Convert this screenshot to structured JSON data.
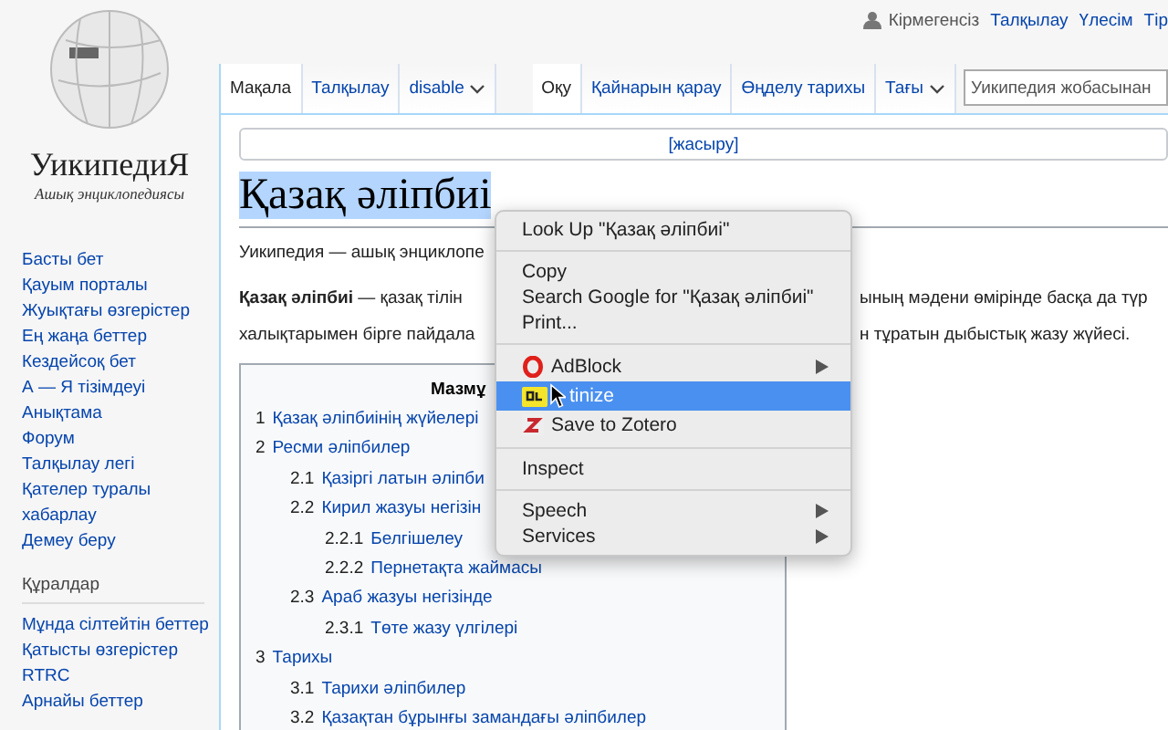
{
  "logo": {
    "title": "УикипедиЯ",
    "subtitle": "Ашық энциклопедиясы"
  },
  "personal": [
    "Кірмегенсіз",
    "Талқылау",
    "Үлесім",
    "Тір"
  ],
  "left_tabs": [
    {
      "label": "Мақала",
      "selected": true,
      "dropdown": false
    },
    {
      "label": "Талқылау",
      "selected": false,
      "dropdown": false
    },
    {
      "label": "disable",
      "selected": false,
      "dropdown": true
    }
  ],
  "right_tabs": [
    {
      "label": "Оқу",
      "selected": true,
      "dropdown": false
    },
    {
      "label": "Қайнарын қарау",
      "selected": false,
      "dropdown": false
    },
    {
      "label": "Өңделу тарихы",
      "selected": false,
      "dropdown": false
    },
    {
      "label": "Тағы",
      "selected": false,
      "dropdown": true
    }
  ],
  "search": {
    "placeholder": "Уикипедия жобасынан"
  },
  "notice": {
    "link": "[жасыру]"
  },
  "sidebar": {
    "nav": [
      "Басты бет",
      "Қауым порталы",
      "Жуықтағы өзгерістер",
      "Ең жаңа беттер",
      "Кездейсоқ бет",
      "А — Я тізімдеуі",
      "Анықтама",
      "Форум",
      "Талқылау легі",
      "Қателер туралы хабарлау",
      "Демеу беру"
    ],
    "tools_heading": "Құралдар",
    "tools": [
      "Мұнда сілтейтін беттер",
      "Қатысты өзгерістер",
      "RTRC",
      "Арнайы беттер"
    ]
  },
  "article": {
    "title": "Қазақ әліпбиі",
    "lines": [
      {
        "left": "Уикипедия — ашық энциклопе"
      },
      {
        "left": "**Қазақ әліпбиі** — қазақ тілін",
        "right": "ының мәдени өмірінде басқа да түр"
      },
      {
        "left": "халықтарымен бірге пайдала",
        "right": "н тұратын дыбыстық жазу жүйесі."
      }
    ],
    "toc": {
      "title": "Мазмұ",
      "items": [
        {
          "number": "1",
          "text": "Қазақ әліпбиінің жүйелері"
        },
        {
          "number": "2",
          "text": "Ресми әліпбилер",
          "children": [
            {
              "number": "2.1",
              "text": "Қазіргі латын әліпби"
            },
            {
              "number": "2.2",
              "text": "Кирил жазуы негізін",
              "children": [
                {
                  "number": "2.2.1",
                  "text": "Белгішелеу"
                },
                {
                  "number": "2.2.2",
                  "text": "Пернетақта жаймасы"
                }
              ]
            },
            {
              "number": "2.3",
              "text": "Араб жазуы негізінде",
              "children": [
                {
                  "number": "2.3.1",
                  "text": "Төте жазу үлгілері"
                }
              ]
            }
          ]
        },
        {
          "number": "3",
          "text": "Тарихы",
          "children": [
            {
              "number": "3.1",
              "text": "Тарихи әліпбилер"
            },
            {
              "number": "3.2",
              "text": "Қазақтан бұрынғы замандағы әліпбилер"
            }
          ]
        }
      ]
    }
  },
  "context_menu": [
    {
      "kind": "item",
      "label": "Look Up \"Қазақ әліпбиі\"",
      "submenu": false,
      "selected": false
    },
    {
      "kind": "separator"
    },
    {
      "kind": "item",
      "label": "Copy",
      "submenu": false,
      "selected": false
    },
    {
      "kind": "item",
      "label": "Search Google for \"Қазақ әліпбиі\"",
      "submenu": false,
      "selected": false
    },
    {
      "kind": "item",
      "label": "Print...",
      "submenu": false,
      "selected": false
    },
    {
      "kind": "separator"
    },
    {
      "kind": "extension",
      "label": "AdBlock",
      "submenu": true,
      "selected": false
    },
    {
      "kind": "extension",
      "label": "tinize",
      "submenu": false,
      "selected": true
    },
    {
      "kind": "extension",
      "label": "Save to Zotero",
      "submenu": false,
      "selected": false
    },
    {
      "kind": "separator"
    },
    {
      "kind": "item",
      "label": "Inspect",
      "submenu": false,
      "selected": false
    },
    {
      "kind": "separator"
    },
    {
      "kind": "item",
      "label": "Speech",
      "submenu": true,
      "selected": false
    },
    {
      "kind": "item",
      "label": "Services",
      "submenu": true,
      "selected": false
    }
  ]
}
